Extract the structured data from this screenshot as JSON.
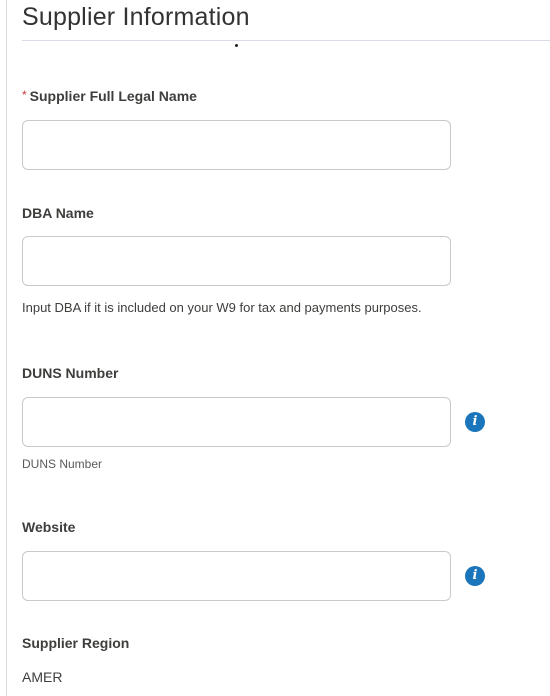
{
  "section": {
    "title": "Supplier Information"
  },
  "fields": {
    "legal_name": {
      "label": "Supplier Full Legal Name",
      "required_marker": "*",
      "value": "",
      "placeholder": ""
    },
    "dba_name": {
      "label": "DBA Name",
      "value": "",
      "placeholder": "",
      "help": "Input DBA if it is included on your W9 for tax and payments purposes."
    },
    "duns_number": {
      "label": "DUNS Number",
      "value": "",
      "placeholder": "",
      "help": "DUNS Number",
      "info_icon": "info-icon"
    },
    "website": {
      "label": "Website",
      "value": "",
      "placeholder": "",
      "info_icon": "info-icon"
    },
    "region": {
      "label": "Supplier Region",
      "value": "AMER"
    }
  },
  "colors": {
    "required": "#c23934",
    "info_icon": "#1b75bb",
    "input_border": "#c9c9c9"
  }
}
